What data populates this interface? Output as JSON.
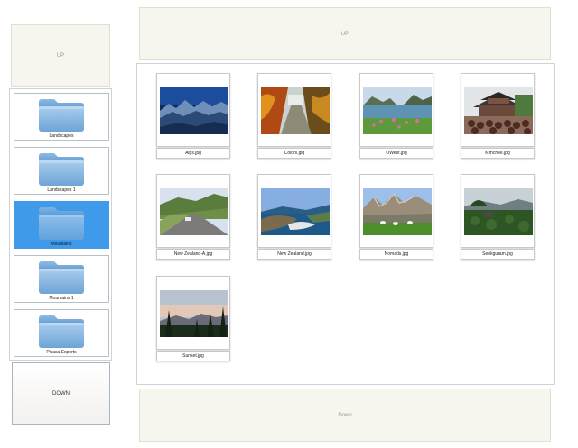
{
  "left_up_label": "UP",
  "left_down_label": "DOWN",
  "folders": [
    {
      "label": "Landscapes"
    },
    {
      "label": "Landscapes 1"
    },
    {
      "label": "Mountains",
      "selected": true
    },
    {
      "label": "Mountains 1"
    },
    {
      "label": "Picasa Exports"
    }
  ],
  "right_up_label": "UP",
  "right_down_label": "Down",
  "images": [
    {
      "name": "Alps.jpg",
      "scene": "alps"
    },
    {
      "name": "Colors.jpg",
      "scene": "colors"
    },
    {
      "name": "OWest.jpg",
      "scene": "owest"
    },
    {
      "name": "Kimchee.jpg",
      "scene": "kimchee"
    },
    {
      "name": "New Zealand-A.jpg",
      "scene": "nza"
    },
    {
      "name": "New Zealand.jpg",
      "scene": "nz"
    },
    {
      "name": "Nomads.jpg",
      "scene": "nomads"
    },
    {
      "name": "Seokguram.jpg",
      "scene": "seokguram"
    },
    {
      "name": "Sunset.jpg",
      "scene": "sunset"
    }
  ],
  "icons": {
    "folder": "folder-icon",
    "thumbnail": "photo-thumbnail"
  },
  "colors": {
    "selected": "#3f9bea",
    "panel_border": "#cfd2d6",
    "button_bg": "#f6f5ee"
  }
}
